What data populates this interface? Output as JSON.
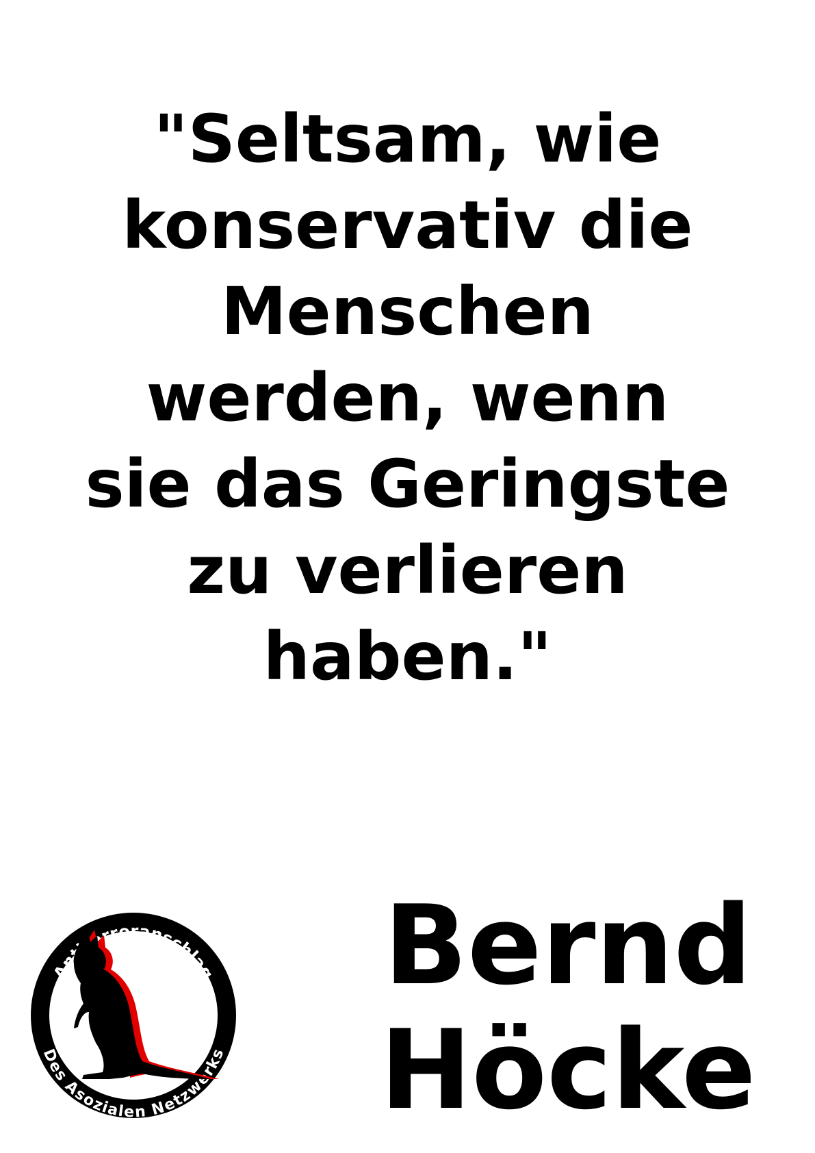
{
  "quote": {
    "lines": [
      "\"Seltsam, wie",
      "konservativ die",
      "Menschen",
      "werden, wenn",
      "sie das Geringste",
      "zu verlieren",
      "haben.\""
    ]
  },
  "author": {
    "lines": [
      "Bernd",
      "Höcke"
    ]
  },
  "logo": {
    "top_text": "Antiterroranschlag",
    "bottom_text": "Des Asozialen Netzwerks",
    "icon": "kangaroo-icon",
    "colors": {
      "ring": "#000000",
      "ring_text": "#ffffff",
      "kangaroo": "#000000",
      "kangaroo_shadow": "#e00000"
    }
  }
}
